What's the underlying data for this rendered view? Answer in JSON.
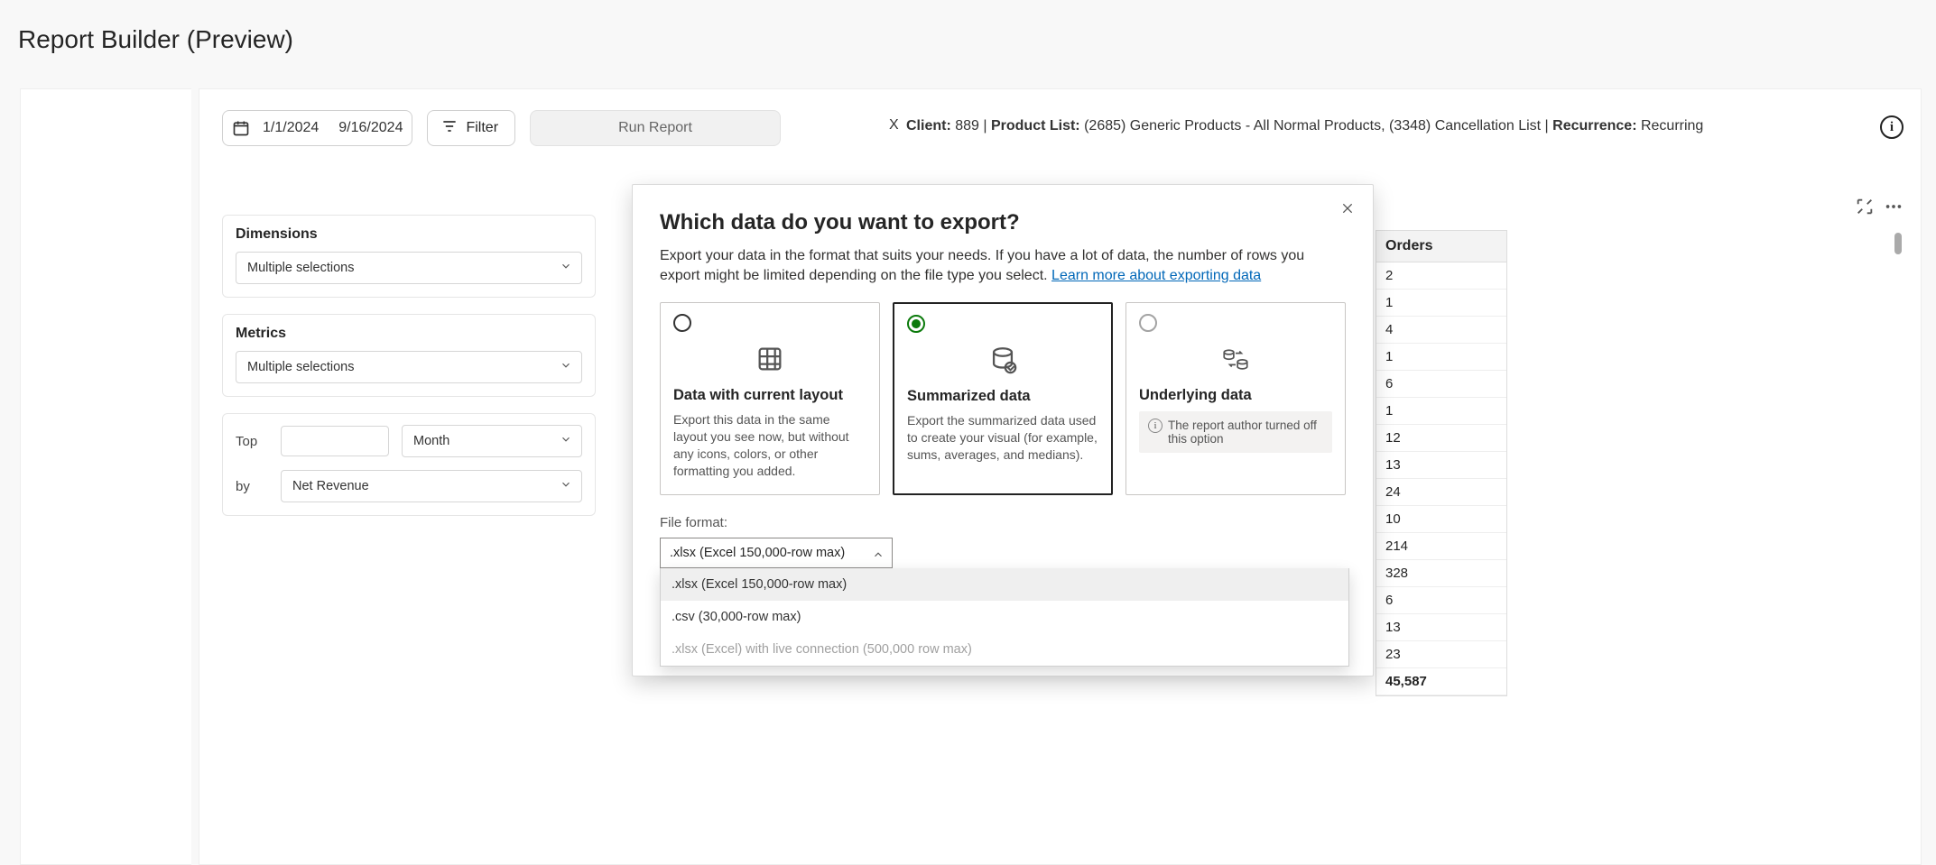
{
  "page_title": "Report Builder (Preview)",
  "toolbar": {
    "date_start": "1/1/2024",
    "date_end": "9/16/2024",
    "filter_label": "Filter",
    "run_label": "Run Report"
  },
  "context": {
    "client_label": "Client:",
    "client_value": " 889 | ",
    "product_list_label": "Product List:",
    "product_list_value": " (2685) Generic Products - All Normal Products, (3348) Cancellation List | ",
    "recurrence_label": "Recurrence:",
    "recurrence_value": " Recurring"
  },
  "controls": {
    "dimensions_label": "Dimensions",
    "dimensions_value": "Multiple selections",
    "metrics_label": "Metrics",
    "metrics_value": "Multiple selections",
    "top_label": "Top",
    "top_unit": "Month",
    "by_label": "by",
    "by_value": "Net Revenue"
  },
  "orders": {
    "header": "Orders",
    "rows": [
      "2",
      "1",
      "4",
      "1",
      "6",
      "1",
      "12",
      "13",
      "24",
      "10",
      "214",
      "328",
      "6",
      "13",
      "23"
    ],
    "total": "45,587"
  },
  "dialog": {
    "title": "Which data do you want to export?",
    "desc": "Export your data in the format that suits your needs. If you have a lot of data, the number of rows you export might be limited depending on the file type you select.  ",
    "learn_more": "Learn more about exporting data",
    "cards": [
      {
        "title": "Data with current layout",
        "body": "Export this data in the same layout you see now, but without any icons, colors, or other formatting you added."
      },
      {
        "title": "Summarized data",
        "body": "Export the summarized data used to create your visual (for example, sums, averages, and medians)."
      },
      {
        "title": "Underlying data",
        "body": "The report author turned off this option"
      }
    ],
    "file_format_label": "File format:",
    "file_format_selected": ".xlsx (Excel 150,000-row max)",
    "file_format_options": [
      ".xlsx (Excel 150,000-row max)",
      ".csv (30,000-row max)",
      ".xlsx (Excel) with live connection (500,000 row max)"
    ]
  }
}
